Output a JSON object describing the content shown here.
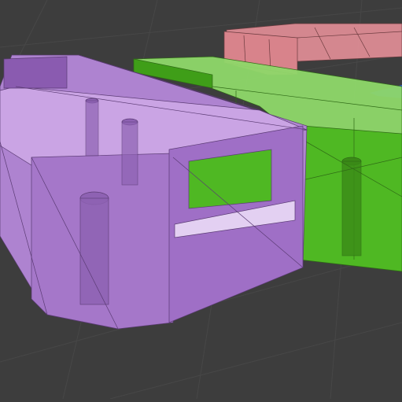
{
  "viewport": {
    "label": "",
    "background_color": "#3d3d3d",
    "grid_color": "#4a4a4a"
  },
  "objects": [
    {
      "id": "purple",
      "name": "",
      "color": "#b386d6"
    },
    {
      "id": "green",
      "name": "",
      "color": "#58c32a"
    },
    {
      "id": "red",
      "name": "",
      "color": "#e59098"
    },
    {
      "id": "blue",
      "name": "",
      "color": "#2b5fe0"
    }
  ]
}
